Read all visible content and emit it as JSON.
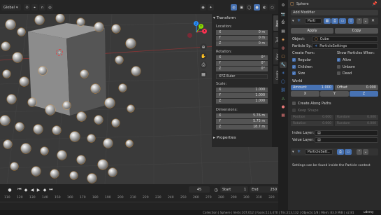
{
  "viewport": {
    "orientation": "Global",
    "cursor_mark": "+",
    "axes": {
      "x": "X",
      "y": "Y",
      "z": "Z"
    }
  },
  "npanel": {
    "transform_title": "Transform",
    "location_label": "Location:",
    "location": [
      [
        "X",
        "0 m"
      ],
      [
        "Y",
        "0 m"
      ],
      [
        "Z",
        "0 m"
      ]
    ],
    "rotation_label": "Rotation:",
    "rotation": [
      [
        "X",
        "0°"
      ],
      [
        "Y",
        "0°"
      ],
      [
        "Z",
        "0°"
      ]
    ],
    "rotation_mode": "XYZ Euler",
    "scale_label": "Scale:",
    "scale": [
      [
        "X",
        "1.000"
      ],
      [
        "Y",
        "1.000"
      ],
      [
        "Z",
        "1.000"
      ]
    ],
    "dimensions_label": "Dimensions:",
    "dimensions": [
      [
        "X",
        "5.76 m"
      ],
      [
        "Y",
        "5.75 m"
      ],
      [
        "Z",
        "18.7 m"
      ]
    ],
    "properties_title": "Properties",
    "tabs": [
      "Item",
      "Tool",
      "View",
      "Create"
    ]
  },
  "timeline": {
    "current_frame": "45",
    "start_label": "Start",
    "start_value": "1",
    "end_label": "End",
    "end_value": "250",
    "ticks": [
      "110",
      "120",
      "130",
      "140",
      "150",
      "160",
      "170",
      "180",
      "190",
      "200",
      "210",
      "220",
      "230",
      "240",
      "250",
      "260",
      "270",
      "280",
      "290",
      "300",
      "310",
      "320"
    ]
  },
  "status_bar": {
    "text": "Collection | Sphere | Verts:107,012 | Faces:113,470 | Tris:213,132 | Objects:1/8 | Mem: 83.0 MiB | v2.81",
    "watermark": "udemy"
  },
  "props": {
    "object_name": "Sphere",
    "add_modifier": "Add Modifier",
    "modifier_name": "Parti",
    "apply_label": "Apply",
    "copy_label": "Copy",
    "object_label": "Object:",
    "object_value": "Cube",
    "particle_sys_label": "Particle Sy..",
    "particle_sys_value": "ParticleSettings",
    "create_from_label": "Create From:",
    "create_from": [
      {
        "label": "Regular",
        "checked": true
      },
      {
        "label": "Children",
        "checked": true
      },
      {
        "label": "Size",
        "checked": true
      }
    ],
    "show_when_label": "Show Particles When:",
    "show_when": [
      {
        "label": "Alive",
        "checked": true
      },
      {
        "label": "Unborn",
        "checked": false
      },
      {
        "label": "Dead",
        "checked": false
      }
    ],
    "world_label": "World",
    "amount_label": "Amount",
    "amount_value": "1.000",
    "offset_label": "Offset",
    "offset_value": "0.000",
    "axis_buttons": [
      "X",
      "Y",
      "Z"
    ],
    "create_along_paths": "Create Along Paths",
    "keep_shape": "Keep Shape",
    "position_label": "Position",
    "position_value": "0.000",
    "random_label": "Random",
    "random_value": "0.000",
    "rotation_label": "Rotation",
    "rotation_value": "0.000",
    "random2_label": "Random",
    "random2_value": "0.000",
    "index_layer_label": "Index Layer:",
    "value_layer_label": "Value Layer:",
    "modifier2_name": "ParticleSett..",
    "info_text": "Settings can be found inside the Particle context"
  },
  "colors": {
    "accent": "#4772b3",
    "x_axis": "#ff3352",
    "y_axis": "#8bdc00",
    "z_axis": "#2890ff",
    "selection": "#ffaa40"
  }
}
